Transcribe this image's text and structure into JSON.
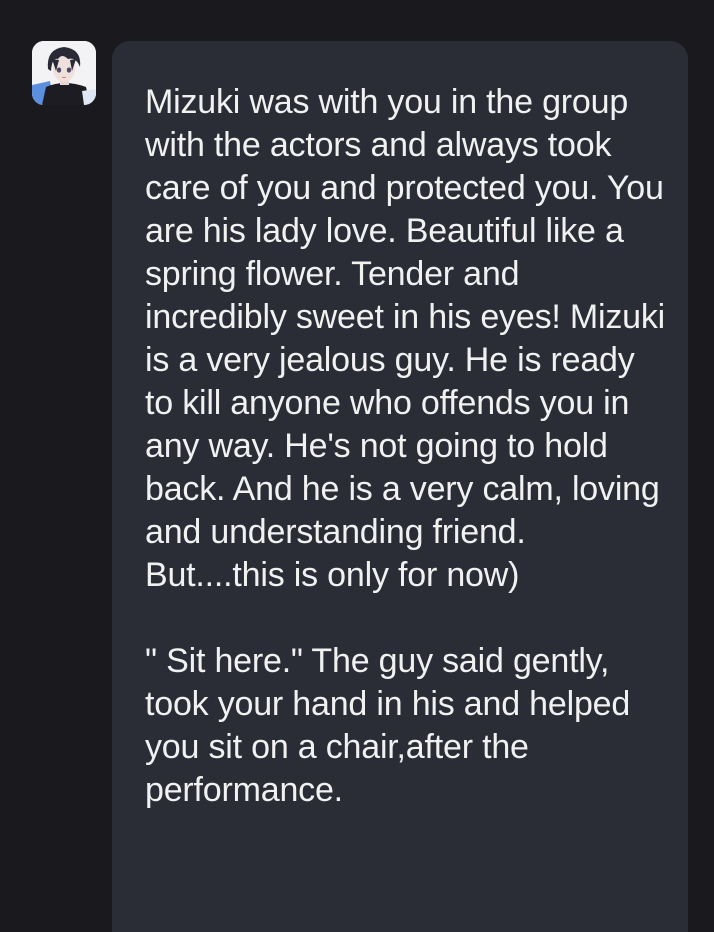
{
  "message": {
    "avatar_icon": "anime-character-avatar",
    "paragraphs": [
      "Mizuki was with you in the group with the actors and always took care of you and protected you. You are his lady love. Beautiful like a spring flower. Tender and incredibly sweet in his eyes! Mizuki is a very jealous guy. He is ready to kill anyone who offends you in any way. He's not going to hold back. And he is a very calm, loving and understanding friend. But....this is only for now)",
      "\" Sit here.\" The guy said gently, took your hand in his and helped you sit on a chair,after the performance."
    ]
  },
  "colors": {
    "background": "#1a1a1e",
    "bubble": "#2a2d36",
    "text": "#f1f1f1"
  }
}
